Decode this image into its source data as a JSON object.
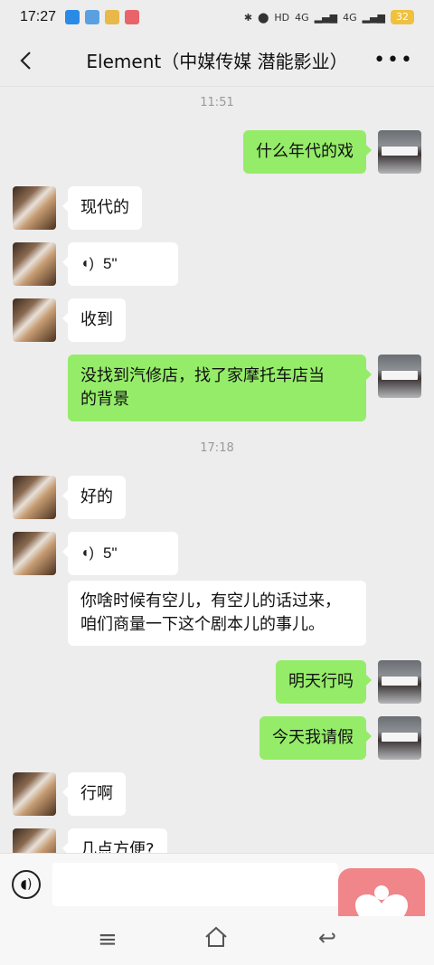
{
  "status_bar": {
    "time": "17:27",
    "network_1": "4G",
    "network_2": "4G",
    "battery": "32"
  },
  "header": {
    "back_icon": "chevron-left-icon",
    "title": "Element（中媒传媒 潜能影业）",
    "more_icon": "ellipsis-icon"
  },
  "timestamps": [
    "11:51",
    "17:18"
  ],
  "messages": [
    {
      "side": "right",
      "type": "text",
      "text": "什么年代的戏"
    },
    {
      "side": "left",
      "type": "text",
      "text": "现代的"
    },
    {
      "side": "left",
      "type": "voice",
      "text": "5\""
    },
    {
      "side": "left",
      "type": "text",
      "text": "收到"
    },
    {
      "side": "right",
      "type": "text",
      "line1": "没找到汽修店，找了家摩托车店当",
      "line2": "的背景"
    },
    {
      "side": "left",
      "type": "text",
      "text": "好的"
    },
    {
      "side": "left",
      "type": "voice",
      "text": "5\""
    },
    {
      "side": "left",
      "type": "text",
      "line1": "你啥时候有空儿，有空儿的话过来，",
      "line2": "咱们商量一下这个剧本儿的事儿。"
    },
    {
      "side": "right",
      "type": "text",
      "text": "明天行吗"
    },
    {
      "side": "right",
      "type": "text",
      "text": "今天我请假"
    },
    {
      "side": "left",
      "type": "text",
      "text": "行啊"
    },
    {
      "side": "left",
      "type": "text",
      "text": "几点方便?"
    }
  ],
  "input_bar": {
    "voice_icon": "voice-input-icon",
    "placeholder": ""
  },
  "floating_button": {
    "icon": "heart-person-icon",
    "color": "#f0868a"
  },
  "nav_bar": {
    "menu_icon": "menu-icon",
    "home_icon": "home-icon",
    "back_icon": "back-icon"
  },
  "colors": {
    "sent_bubble": "#95ec69",
    "received_bubble": "#ffffff",
    "background": "#ededed"
  }
}
